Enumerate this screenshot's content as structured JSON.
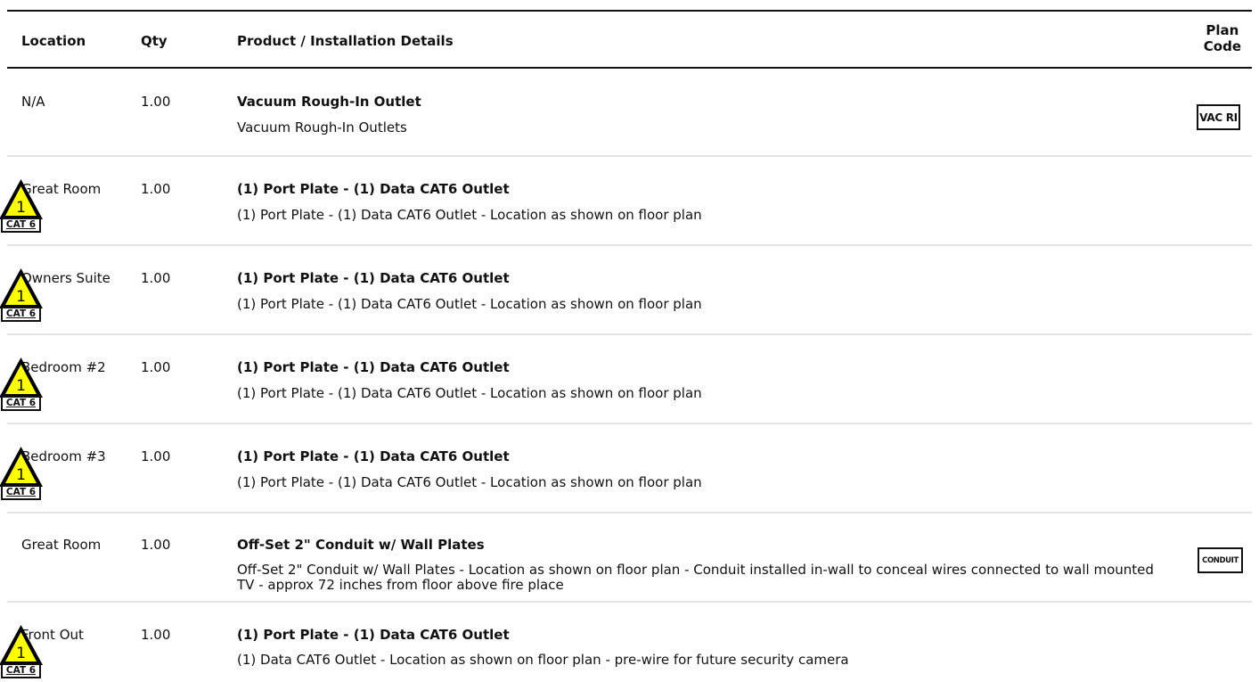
{
  "header": {
    "location": "Location",
    "qty": "Qty",
    "details": "Product / Installation Details",
    "plan_code_line1": "Plan",
    "plan_code_line2": "Code"
  },
  "rows": [
    {
      "location": "N/A",
      "qty": "1.00",
      "title": "Vacuum Rough-In Outlet",
      "desc": "Vacuum Rough-In Outlets",
      "code": "VAC RI"
    },
    {
      "location": "Great Room",
      "qty": "1.00",
      "title": "(1) Port Plate - (1) Data CAT6 Outlet",
      "desc": "(1) Port Plate - (1) Data CAT6 Outlet - Location as shown on floor plan",
      "code_num": "1",
      "code_label": "CAT 6"
    },
    {
      "location": "Owners Suite",
      "qty": "1.00",
      "title": "(1) Port Plate - (1) Data CAT6 Outlet",
      "desc": "(1) Port Plate - (1) Data CAT6 Outlet - Location as shown on floor plan",
      "code_num": "1",
      "code_label": "CAT 6"
    },
    {
      "location": "Bedroom #2",
      "qty": "1.00",
      "title": "(1) Port Plate - (1) Data CAT6 Outlet",
      "desc": "(1) Port Plate - (1) Data CAT6 Outlet - Location as shown on floor plan",
      "code_num": "1",
      "code_label": "CAT 6"
    },
    {
      "location": "Bedroom #3",
      "qty": "1.00",
      "title": "(1) Port Plate - (1) Data CAT6 Outlet",
      "desc": "(1) Port Plate - (1) Data CAT6 Outlet - Location as shown on floor plan",
      "code_num": "1",
      "code_label": "CAT 6"
    },
    {
      "location": "Great Room",
      "qty": "1.00",
      "title": "Off-Set 2\" Conduit w/ Wall Plates",
      "desc": "Off-Set 2\" Conduit w/ Wall Plates - Location as shown on floor plan - Conduit installed in-wall to conceal wires connected to wall mounted TV - approx 72 inches from floor above fire place",
      "code": "CONDUIT"
    },
    {
      "location": "Front Out",
      "qty": "1.00",
      "title": "(1) Port Plate - (1) Data CAT6 Outlet",
      "desc": "(1) Data CAT6 Outlet - Location as shown on floor plan - pre-wire for future security camera",
      "code_num": "1",
      "code_label": "CAT 6"
    }
  ],
  "colors": {
    "warning_yellow": "#ffff00",
    "rule": "#111111",
    "row_divider": "#e3e3e3"
  }
}
